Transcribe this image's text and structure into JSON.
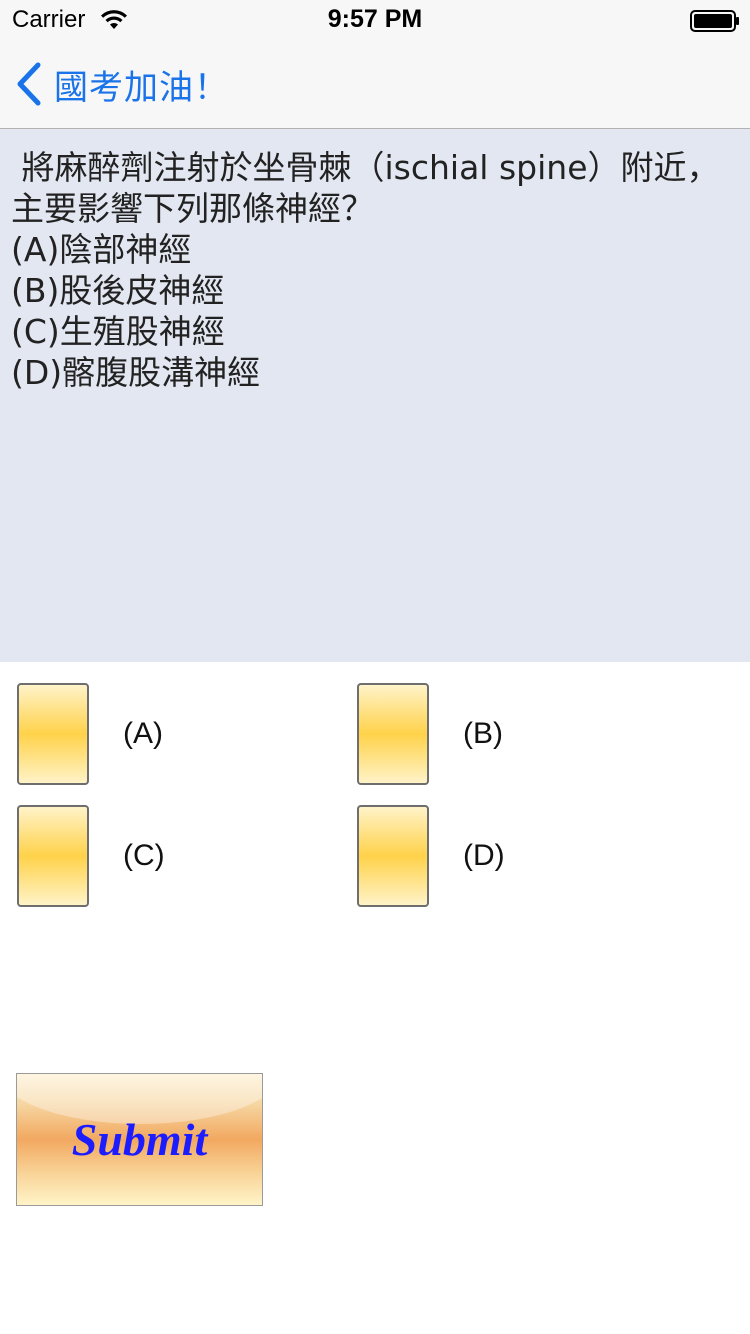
{
  "status_bar": {
    "carrier": "Carrier",
    "time": "9:57 PM"
  },
  "nav": {
    "back_label": "國考加油！",
    "accent_color": "#1a73e8"
  },
  "question": {
    "text": " 將麻醉劑注射於坐骨棘（ischial spine）附近，\n主要影響下列那條神經？\n(A)陰部神經\n(B)股後皮神經\n(C)生殖股神經\n(D)髂腹股溝神經"
  },
  "options": [
    {
      "label": "(A)"
    },
    {
      "label": "(B)"
    },
    {
      "label": "(C)"
    },
    {
      "label": "(D)"
    }
  ],
  "submit": {
    "label": "Submit"
  },
  "icons": {
    "wifi": "wifi-icon",
    "battery": "battery-icon",
    "back": "chevron-left-icon"
  }
}
